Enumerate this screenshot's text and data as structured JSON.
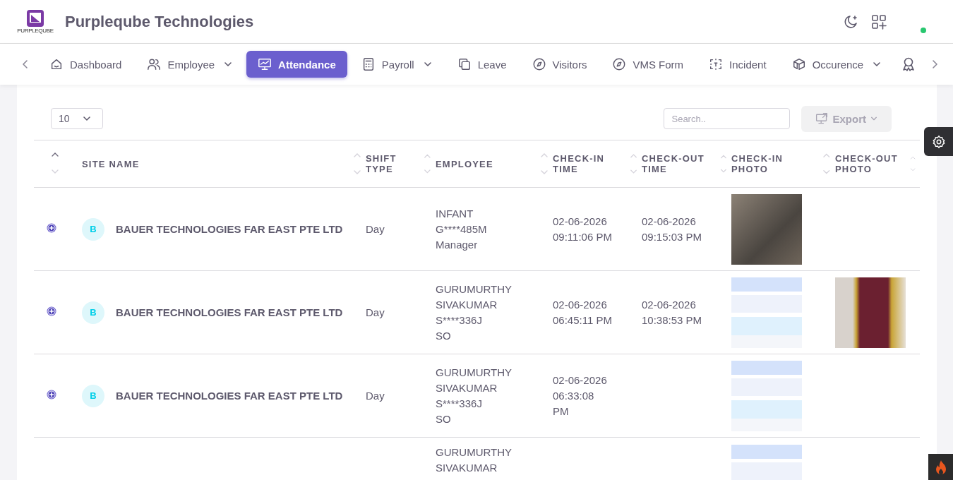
{
  "header": {
    "brand_text": "PURPLEQUBE",
    "title": "Purpleqube Technologies",
    "online": true
  },
  "nav": {
    "items": [
      {
        "label": "Dashboard",
        "kind": "home",
        "dropdown": false,
        "selected": false
      },
      {
        "label": "Employee",
        "kind": "users",
        "dropdown": true,
        "selected": false
      },
      {
        "label": "Attendance",
        "kind": "monitor",
        "dropdown": false,
        "selected": true
      },
      {
        "label": "Payroll",
        "kind": "calculator",
        "dropdown": true,
        "selected": false
      },
      {
        "label": "Leave",
        "kind": "copy",
        "dropdown": false,
        "selected": false
      },
      {
        "label": "Visitors",
        "kind": "compass",
        "dropdown": false,
        "selected": false
      },
      {
        "label": "VMS Form",
        "kind": "compass",
        "dropdown": false,
        "selected": false
      },
      {
        "label": "Incident",
        "kind": "focus",
        "dropdown": false,
        "selected": false
      },
      {
        "label": "Occurence",
        "kind": "box",
        "dropdown": true,
        "selected": false
      }
    ]
  },
  "toolbar": {
    "page_size": "10",
    "search_placeholder": "Search..",
    "export_label": "Export",
    "export_disabled": true
  },
  "table": {
    "columns": [
      "SITE NAME",
      "SHIFT TYPE",
      "EMPLOYEE",
      "CHECK-IN TIME",
      "CHECK-OUT TIME",
      "CHECK-IN PHOTO",
      "CHECK-OUT PHOTO"
    ],
    "rows": [
      {
        "avatar": "B",
        "site": "BAUER TECHNOLOGIES FAR EAST PTE LTD",
        "shift": "Day",
        "employee": [
          "INFANT",
          "G****485M",
          "Manager"
        ],
        "check_in": [
          "02-06-2026",
          "09:11:06 PM"
        ],
        "check_out": [
          "02-06-2026",
          "09:15:03 PM"
        ],
        "photos": [
          {
            "kind": "photo"
          },
          {
            "kind": "none"
          }
        ]
      },
      {
        "avatar": "B",
        "site": "BAUER TECHNOLOGIES FAR EAST PTE LTD",
        "shift": "Day",
        "employee": [
          "GURUMURTHY",
          "SIVAKUMAR",
          "S****336J",
          "SO"
        ],
        "check_in": [
          "02-06-2026",
          "06:45:11 PM"
        ],
        "check_out": [
          "02-06-2026",
          "10:38:53 PM"
        ],
        "photos": [
          {
            "kind": "screenshot"
          },
          {
            "kind": "photo"
          }
        ]
      },
      {
        "avatar": "B",
        "site": "BAUER TECHNOLOGIES FAR EAST PTE LTD",
        "shift": "Day",
        "employee": [
          "GURUMURTHY",
          "SIVAKUMAR",
          "S****336J",
          "SO"
        ],
        "check_in": [
          "02-06-2026",
          "06:33:08",
          "PM"
        ],
        "check_out": [],
        "photos": [
          {
            "kind": "screenshot"
          },
          {
            "kind": "none"
          }
        ]
      },
      {
        "employee": [
          "GURUMURTHY",
          "SIVAKUMAR"
        ],
        "check_in": [],
        "check_out": [],
        "photos": [
          {
            "kind": "screenshot"
          },
          {
            "kind": "none"
          }
        ]
      }
    ]
  }
}
